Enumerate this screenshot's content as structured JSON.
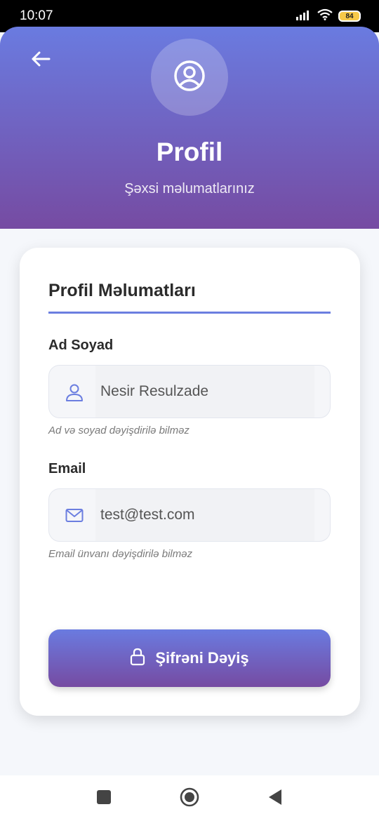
{
  "status_bar": {
    "time": "10:07",
    "battery_level": "84",
    "icons": [
      "signal-icon",
      "wifi-icon",
      "battery-icon"
    ]
  },
  "header": {
    "back_icon": "arrow-left-icon",
    "avatar_icon": "user-circle-icon",
    "title": "Profil",
    "subtitle": "Şəxsi məlumatlarınız",
    "gradient_start": "#6a7be0",
    "gradient_end": "#764ba2"
  },
  "card": {
    "title": "Profil Məlumatları",
    "name_field": {
      "label": "Ad Soyad",
      "value": "Nesir Resulzade",
      "icon": "user-icon",
      "hint": "Ad və soyad dəyişdirilə bilməz"
    },
    "email_field": {
      "label": "Email",
      "value": "test@test.com",
      "icon": "mail-icon",
      "hint": "Email ünvanı dəyişdirilə bilməz"
    },
    "change_password_button": {
      "label": "Şifrəni Dəyiş",
      "icon": "lock-icon"
    }
  },
  "nav_bar": {
    "icons": [
      "recents-square-icon",
      "home-circle-icon",
      "back-triangle-icon"
    ]
  }
}
